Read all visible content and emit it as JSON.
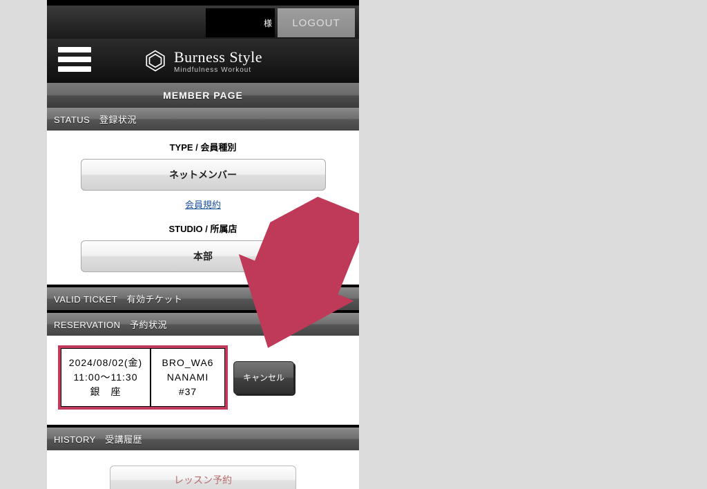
{
  "header": {
    "user_suffix": "様",
    "logout": "LOGOUT",
    "brand_main": "Burness Style",
    "brand_sub": "Mindfulness  Workout",
    "member_page": "MEMBER PAGE"
  },
  "status": {
    "heading": "STATUS　登録状況",
    "type_label": "TYPE / 会員種別",
    "type_value": "ネットメンバー",
    "terms_link": "会員規約",
    "studio_label": "STUDIO / 所属店",
    "studio_value": "本部"
  },
  "valid_ticket": {
    "heading": "VALID TICKET　有効チケット"
  },
  "reservation": {
    "heading": "RESERVATION　予約状況",
    "date_line1": "2024/08/02(金)",
    "date_line2": "11:00～11:30",
    "date_line3": "銀　座",
    "class_line1": "BRO_WA6",
    "class_line2": "NANAMI",
    "class_line3": "#37",
    "cancel": "キャンセル"
  },
  "history": {
    "heading": "HISTORY　受講履歴",
    "lesson_btn": "レッスン予約"
  },
  "colors": {
    "accent_arrow": "#bf3a58",
    "highlight_border": "#c13a5b"
  }
}
